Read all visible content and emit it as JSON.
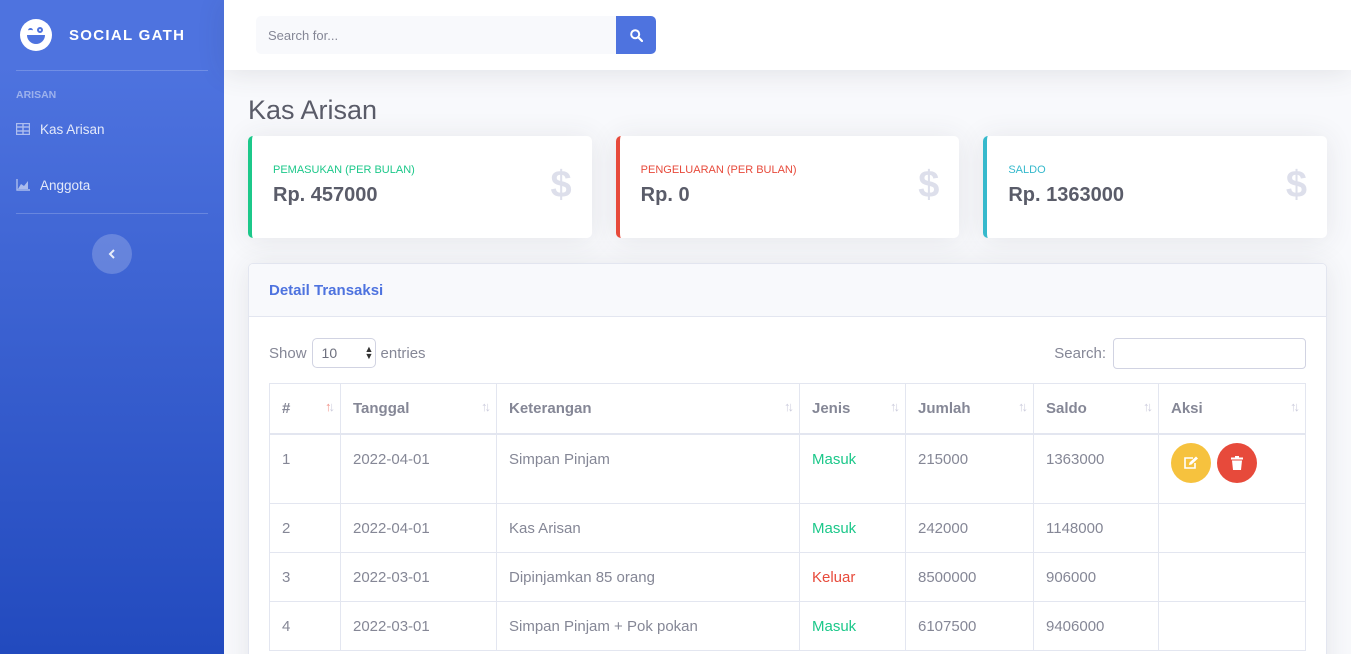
{
  "brand": {
    "name": "SOCIAL GATH",
    "icon": "grin-wink-icon"
  },
  "sidebar": {
    "heading": "ARISAN",
    "items": [
      {
        "label": "Kas Arisan",
        "icon": "table-icon"
      },
      {
        "label": "Anggota",
        "icon": "chart-area-icon"
      }
    ],
    "toggle_icon": "chevron-left-icon"
  },
  "topbar": {
    "search_placeholder": "Search for...",
    "search_icon": "search-icon"
  },
  "page": {
    "title": "Kas Arisan"
  },
  "cards": [
    {
      "label": "PEMASUKAN (PER BULAN)",
      "value": "Rp. 457000",
      "color": "#1cc88a",
      "icon": "dollar-icon"
    },
    {
      "label": "PENGELUARAN (PER BULAN)",
      "value": "Rp. 0",
      "color": "#e74a3b",
      "icon": "dollar-icon"
    },
    {
      "label": "SALDO",
      "value": "Rp. 1363000",
      "color": "#36b9cc",
      "icon": "dollar-icon"
    }
  ],
  "panel": {
    "title": "Detail Transaksi",
    "show_label": "Show",
    "entries_value": "10",
    "entries_label": "entries",
    "search_label": "Search:"
  },
  "table": {
    "columns": [
      "#",
      "Tanggal",
      "Keterangan",
      "Jenis",
      "Jumlah",
      "Saldo",
      "Aksi"
    ],
    "rows": [
      {
        "no": "1",
        "tanggal": "2022-04-01",
        "keterangan": "Simpan Pinjam",
        "jenis": "Masuk",
        "jumlah": "215000",
        "saldo": "1363000"
      },
      {
        "no": "2",
        "tanggal": "2022-04-01",
        "keterangan": "Kas Arisan",
        "jenis": "Masuk",
        "jumlah": "242000",
        "saldo": "1148000"
      },
      {
        "no": "3",
        "tanggal": "2022-03-01",
        "keterangan": "Dipinjamkan 85 orang",
        "jenis": "Keluar",
        "jumlah": "8500000",
        "saldo": "906000"
      },
      {
        "no": "4",
        "tanggal": "2022-03-01",
        "keterangan": "Simpan Pinjam + Pok pokan",
        "jenis": "Masuk",
        "jumlah": "6107500",
        "saldo": "9406000"
      }
    ]
  },
  "colors": {
    "primary": "#4e73df",
    "success": "#1cc88a",
    "danger": "#e74a3b",
    "info": "#36b9cc",
    "warning": "#f6c23e"
  }
}
